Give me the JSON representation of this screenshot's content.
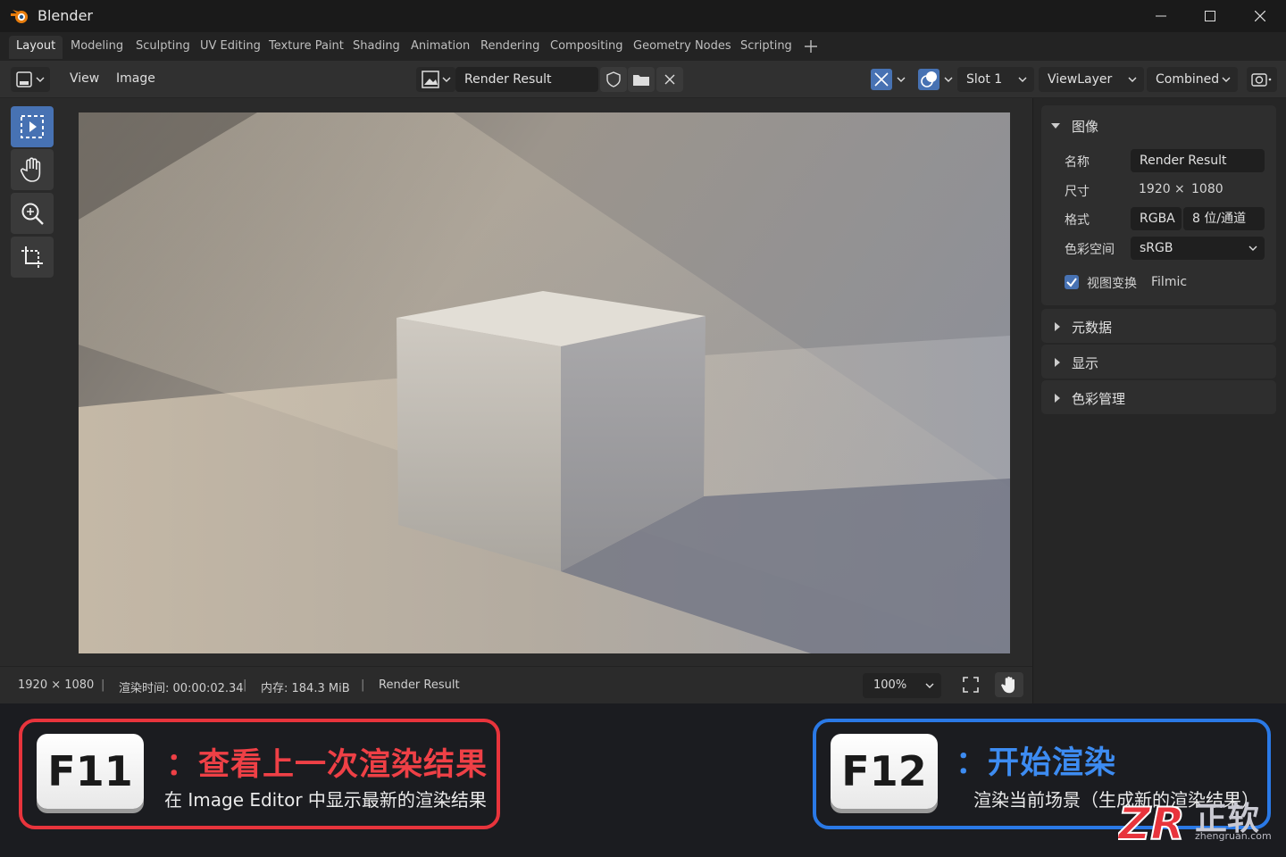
{
  "window": {
    "title": "Blender"
  },
  "workspace_tabs": [
    {
      "label": "Layout",
      "active": true
    },
    {
      "label": "Modeling"
    },
    {
      "label": "Sculpting"
    },
    {
      "label": "UV Editing"
    },
    {
      "label": "Texture Paint"
    },
    {
      "label": "Shading"
    },
    {
      "label": "Animation"
    },
    {
      "label": "Rendering"
    },
    {
      "label": "Compositing"
    },
    {
      "label": "Geometry Nodes"
    },
    {
      "label": "Scripting"
    }
  ],
  "header": {
    "menus": [
      "View",
      "Image"
    ],
    "image_name": "Render Result",
    "slot": "Slot 1",
    "view_layer": "ViewLayer",
    "pass": "Combined"
  },
  "footer": {
    "resolution": "1920 × 1080",
    "render_time": "渲染时间: 00:00:02.34",
    "memory": "内存: 184.3 MiB",
    "image": "Render Result",
    "zoom": "100%"
  },
  "properties": {
    "image_section": "图像",
    "name_label": "名称",
    "name_value": "Render Result",
    "size_label": "尺寸",
    "size_w": "1920",
    "size_x": "×",
    "size_h": "1080",
    "format_label": "格式",
    "format_channels": "RGBA",
    "format_depth": "8 位/通道",
    "colorspace_label": "色彩空间",
    "colorspace_value": "sRGB",
    "view_transform_label": "视图变换",
    "view_transform_value": "Filmic",
    "view_transform_checked": true,
    "collapsed_sections": [
      "元数据",
      "显示",
      "色彩管理"
    ]
  },
  "shortcuts": {
    "f11": {
      "key": "F11",
      "title": "：查看上一次渲染结果",
      "desc": "在 Image Editor 中显示最新的渲染结果"
    },
    "f12": {
      "key": "F12",
      "title": "：开始渲染",
      "desc": "渲染当前场景（生成新的渲染结果）"
    }
  },
  "watermark": {
    "logo": "ZR",
    "name": "正软",
    "url": "zhengruan.com"
  },
  "colors": {
    "accent_blue": "#4772b3",
    "red": "#e8343c",
    "blue": "#2a79e6"
  }
}
